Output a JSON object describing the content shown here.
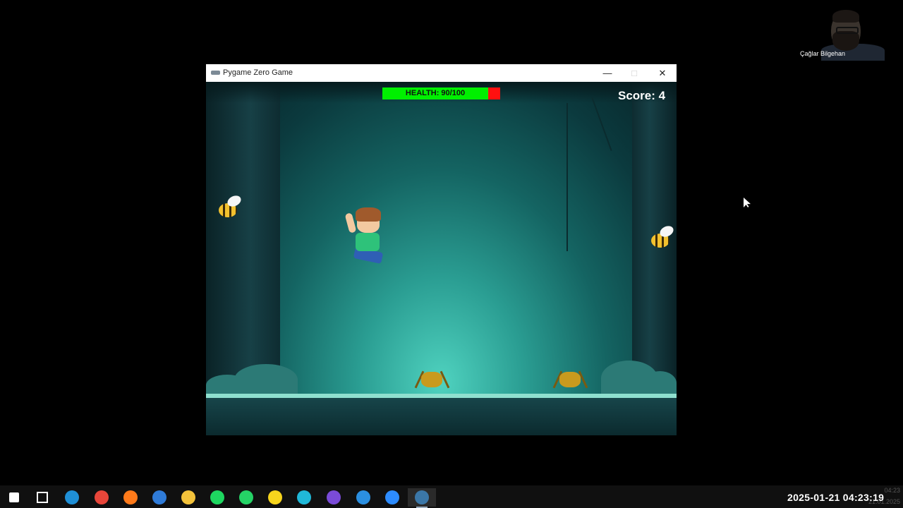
{
  "webcam": {
    "name": "Çağlar Bilgehan"
  },
  "window": {
    "title": "Pygame Zero Game",
    "icon": "gamepad-icon",
    "minimize_symbol": "—",
    "maximize_symbol": "□",
    "close_symbol": "✕"
  },
  "game": {
    "health_text": "HEALTH: 90/100",
    "health": {
      "current": 90,
      "max": 100
    },
    "score_text": "Score: 4",
    "colors": {
      "health_fill": "#00f000",
      "health_missing": "#ff1010"
    }
  },
  "taskbar": {
    "items": [
      {
        "name": "windows-start-icon",
        "color": "#ffffff"
      },
      {
        "name": "task-view-icon",
        "color": "#ffffff"
      },
      {
        "name": "edge-icon",
        "color": "#1f8fd6"
      },
      {
        "name": "chrome-icon",
        "color": "#e8463a"
      },
      {
        "name": "firefox-icon",
        "color": "#ff7a1a"
      },
      {
        "name": "thunderbird-icon",
        "color": "#2f7bd8"
      },
      {
        "name": "file-explorer-icon",
        "color": "#f3c23b"
      },
      {
        "name": "spotify-icon",
        "color": "#1ed760"
      },
      {
        "name": "whatsapp-icon",
        "color": "#25d366"
      },
      {
        "name": "sticky-notes-icon",
        "color": "#f7d51d"
      },
      {
        "name": "canva-icon",
        "color": "#20b8d8"
      },
      {
        "name": "github-desktop-icon",
        "color": "#7a4bd8"
      },
      {
        "name": "vscode-icon",
        "color": "#2b8fe0"
      },
      {
        "name": "zoom-icon",
        "color": "#2d8cff"
      },
      {
        "name": "python-icon",
        "color": "#3b77a8"
      }
    ],
    "clock": "2025-01-21  04:23:19",
    "ghost_time": "04:23",
    "ghost_date": "21.01.2025"
  }
}
